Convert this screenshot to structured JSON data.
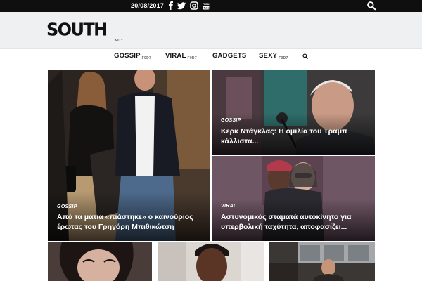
{
  "topbar": {
    "date": "20/08/2017",
    "social_icons": [
      "facebook-icon",
      "twitter-icon",
      "instagram-icon",
      "youtube-icon"
    ],
    "search_icon": "search-icon"
  },
  "brand": {
    "logo_text": "SOUTH",
    "logo_sub": "CITY"
  },
  "nav": {
    "items": [
      {
        "label": "GOSSIP",
        "tag": "F0D7"
      },
      {
        "label": "VIRAL",
        "tag": "F0D7"
      },
      {
        "label": "GADGETS",
        "tag": ""
      },
      {
        "label": "SEXY",
        "tag": "F0D7"
      }
    ]
  },
  "articles": [
    {
      "category": "GOSSIP",
      "title_line1": "Από τα μάτια «πιάστηκε» ο καινούριος",
      "title_line2": "έρωτας του Γρηγόρη Μπιθικώτση"
    },
    {
      "category": "GOSSIP",
      "title_line1": "Κερκ Ντάγκλας: Η ομιλία του Τραμπ",
      "title_line2": "κάλλιστα..."
    },
    {
      "category": "VIRAL",
      "title_line1": "Αστυνομικός σταματά αυτοκίνητο για",
      "title_line2": "υπερβολική ταχύτητα, αποφασίζει..."
    }
  ],
  "colors": {
    "topbar": "#0f0f0f",
    "header_bg": "#eef0f1",
    "nav_border": "#e4e4e4"
  }
}
